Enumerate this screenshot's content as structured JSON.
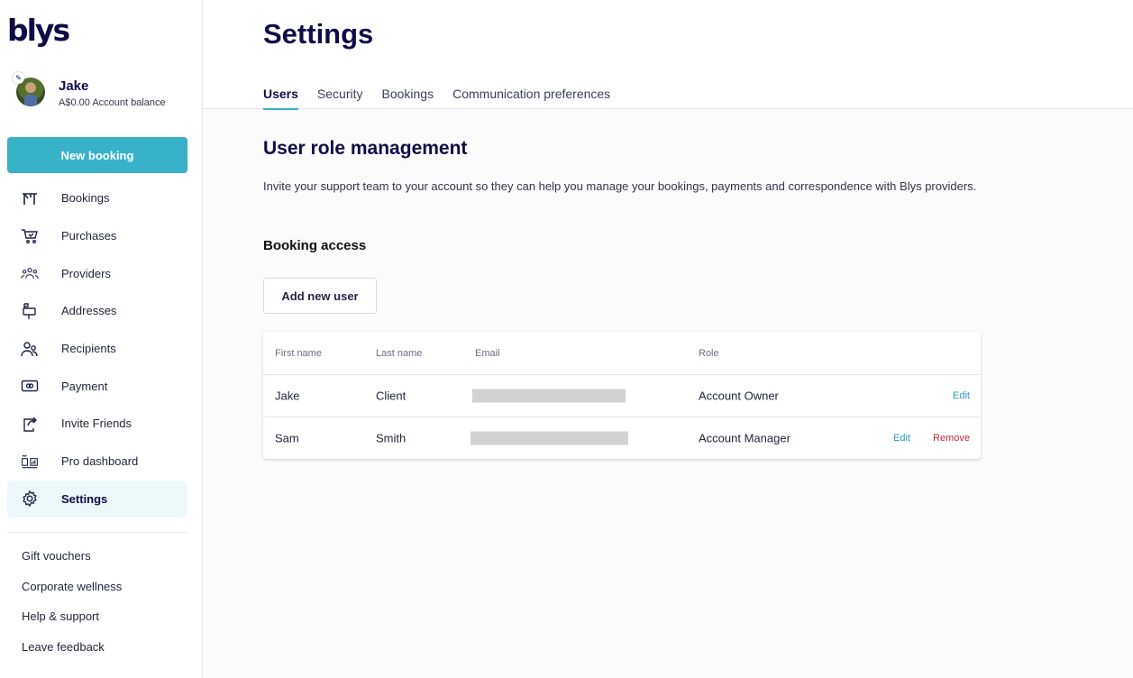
{
  "brand": {
    "logo_text": "blys",
    "accent_color": "#38b2c9",
    "brand_color": "#100c4a",
    "danger_color": "#c52a3a"
  },
  "profile": {
    "name": "Jake",
    "balance": "A$0.00 Account balance"
  },
  "sidebar": {
    "new_booking_label": "New booking",
    "items": [
      {
        "label": "Bookings",
        "icon": "bookings-icon"
      },
      {
        "label": "Purchases",
        "icon": "cart-icon"
      },
      {
        "label": "Providers",
        "icon": "providers-icon"
      },
      {
        "label": "Addresses",
        "icon": "mailbox-icon"
      },
      {
        "label": "Recipients",
        "icon": "recipients-icon"
      },
      {
        "label": "Payment",
        "icon": "payment-icon"
      },
      {
        "label": "Invite Friends",
        "icon": "share-icon"
      },
      {
        "label": "Pro dashboard",
        "icon": "dashboard-icon"
      },
      {
        "label": "Settings",
        "icon": "gear-icon",
        "active": true
      }
    ],
    "links": [
      "Gift vouchers",
      "Corporate wellness",
      "Help & support",
      "Leave feedback"
    ]
  },
  "main": {
    "title": "Settings",
    "tabs": [
      {
        "label": "Users",
        "active": true
      },
      {
        "label": "Security"
      },
      {
        "label": "Bookings"
      },
      {
        "label": "Communication preferences"
      }
    ],
    "section_title": "User role management",
    "section_description": "Invite your support team to your account so they can help you manage your bookings, payments and correspondence with Blys providers.",
    "booking_access_title": "Booking access",
    "add_user_label": "Add new user",
    "table": {
      "headers": [
        "First name",
        "Last name",
        "Email",
        "Role"
      ],
      "rows": [
        {
          "first_name": "Jake",
          "last_name": "Client",
          "role": "Account Owner",
          "edit": "Edit"
        },
        {
          "first_name": "Sam",
          "last_name": "Smith",
          "role": "Account Manager",
          "edit": "Edit",
          "remove": "Remove"
        }
      ]
    }
  }
}
